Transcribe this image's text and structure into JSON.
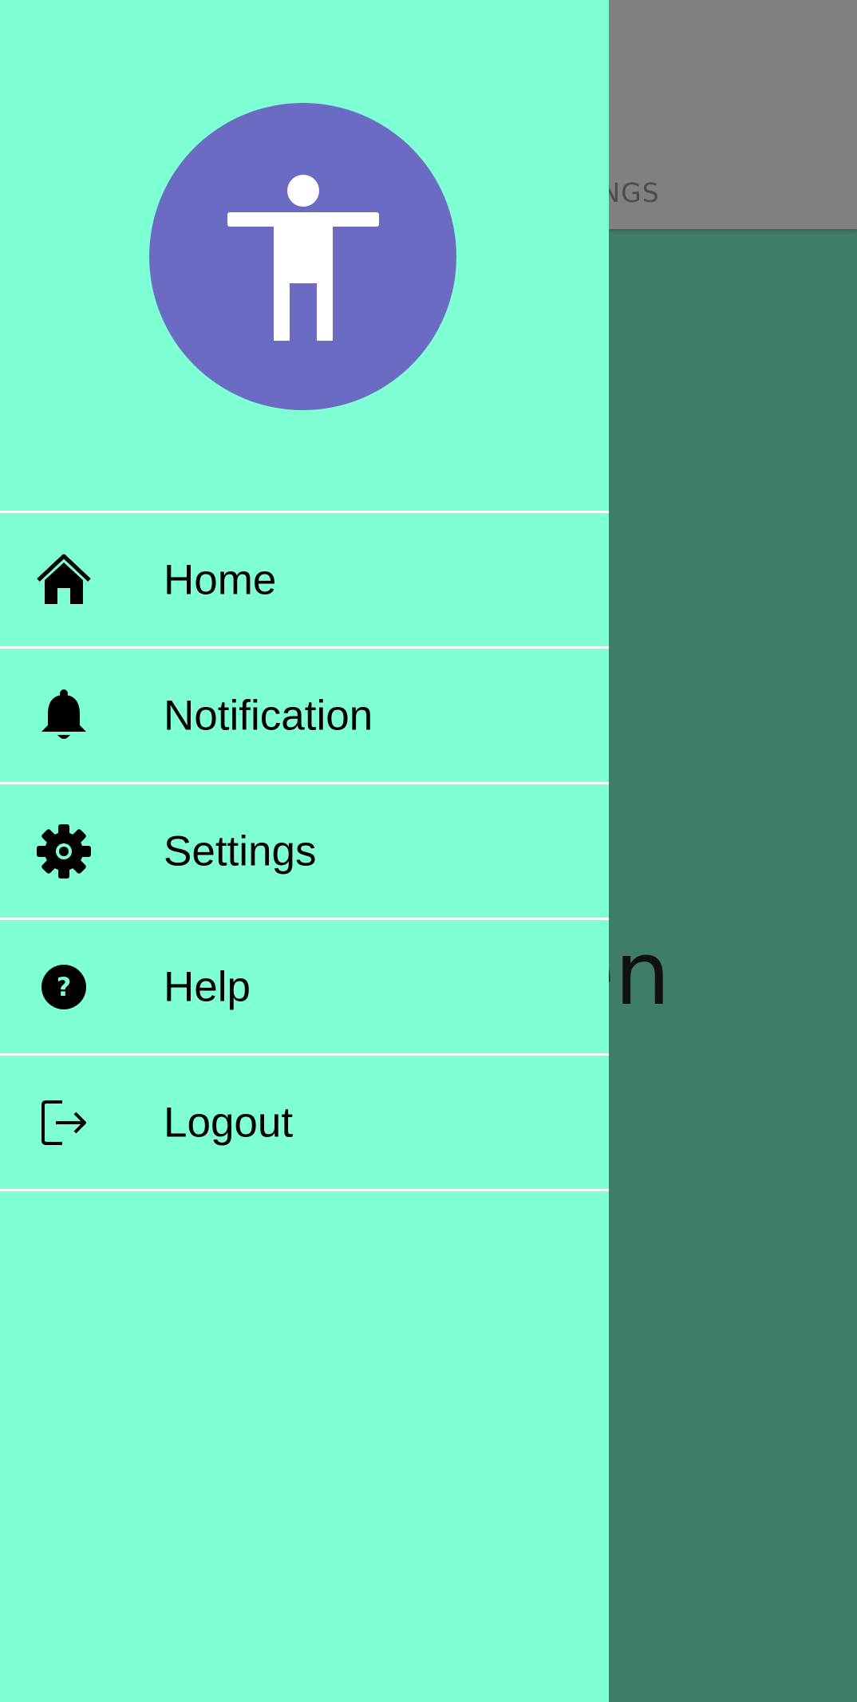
{
  "colors": {
    "drawer_bg": "#7fffd4",
    "avatar_bg": "#6b6bc4",
    "screen_bg": "#3f7d6b",
    "appbar_bg": "#808080",
    "divider": "#ffffff"
  },
  "background_screen": {
    "tab_label": "TTINGS",
    "center_text": "en"
  },
  "drawer": {
    "avatar_icon": "accessibility-icon",
    "items": [
      {
        "label": "Home",
        "icon": "home-icon"
      },
      {
        "label": "Notification",
        "icon": "bell-icon"
      },
      {
        "label": "Settings",
        "icon": "gear-icon"
      },
      {
        "label": "Help",
        "icon": "help-circle-icon"
      },
      {
        "label": "Logout",
        "icon": "logout-icon"
      }
    ]
  }
}
